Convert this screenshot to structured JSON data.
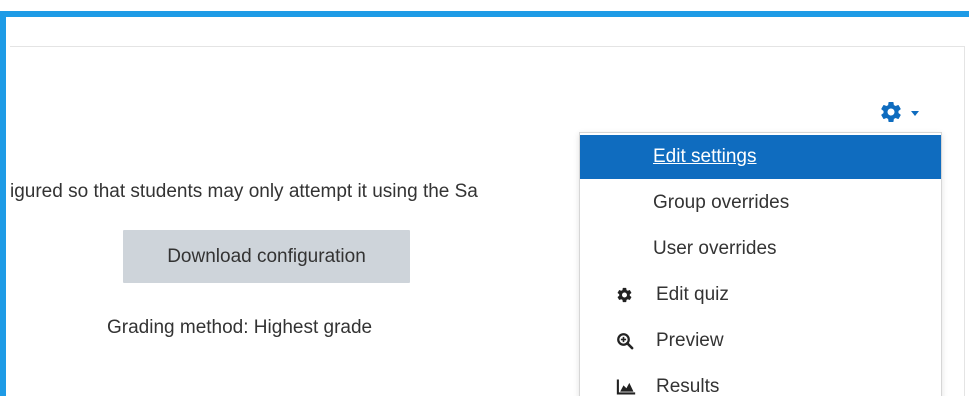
{
  "main": {
    "info_text": "igured so that students may only attempt it using the Sa",
    "download_button_label": "Download configuration",
    "grading_text": "Grading method: Highest grade"
  },
  "menu": {
    "toggle_icon": "gear-icon",
    "items": [
      {
        "label": "Edit settings",
        "icon": null,
        "active": true
      },
      {
        "label": "Group overrides",
        "icon": null,
        "active": false
      },
      {
        "label": "User overrides",
        "icon": null,
        "active": false
      },
      {
        "label": "Edit quiz",
        "icon": "gear-icon",
        "active": false
      },
      {
        "label": "Preview",
        "icon": "zoom-in-icon",
        "active": false
      },
      {
        "label": "Results",
        "icon": "area-chart-icon",
        "active": false
      }
    ]
  },
  "colors": {
    "accent": "#0f6cbf",
    "frame_border": "#1e9be6",
    "button_bg": "#ced4da",
    "text": "#333333"
  }
}
